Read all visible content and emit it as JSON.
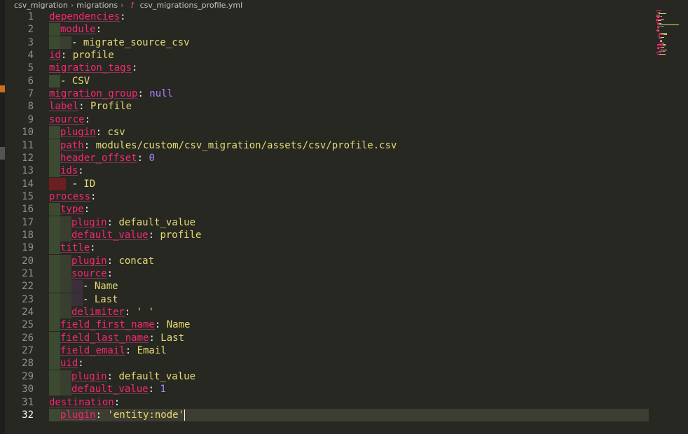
{
  "breadcrumb": {
    "items": [
      "csv_migration",
      "migrations"
    ],
    "icon": "!",
    "file": "csv_migrations_profile.yml"
  },
  "editor": {
    "current_line": 32,
    "lines": [
      {
        "n": "1",
        "indent": 0,
        "tokens": [
          {
            "t": "dependencies",
            "c": "k"
          },
          {
            "t": ":",
            "c": "p"
          }
        ]
      },
      {
        "n": "2",
        "indent": 1,
        "tokens": [
          {
            "t": "module",
            "c": "k"
          },
          {
            "t": ":",
            "c": "p"
          }
        ]
      },
      {
        "n": "3",
        "indent": 2,
        "tokens": [
          {
            "t": "- ",
            "c": "p"
          },
          {
            "t": "migrate_source_csv",
            "c": "s"
          }
        ]
      },
      {
        "n": "4",
        "indent": 0,
        "tokens": [
          {
            "t": "id",
            "c": "k"
          },
          {
            "t": ": ",
            "c": "p"
          },
          {
            "t": "profile",
            "c": "s"
          }
        ]
      },
      {
        "n": "5",
        "indent": 0,
        "tokens": [
          {
            "t": "migration_tags",
            "c": "k"
          },
          {
            "t": ":",
            "c": "p"
          }
        ]
      },
      {
        "n": "6",
        "indent": 1,
        "tokens": [
          {
            "t": "- ",
            "c": "p"
          },
          {
            "t": "CSV",
            "c": "s"
          }
        ]
      },
      {
        "n": "7",
        "indent": 0,
        "tokens": [
          {
            "t": "migration_group",
            "c": "k"
          },
          {
            "t": ": ",
            "c": "p"
          },
          {
            "t": "null",
            "c": "n"
          }
        ]
      },
      {
        "n": "8",
        "indent": 0,
        "tokens": [
          {
            "t": "label",
            "c": "k"
          },
          {
            "t": ": ",
            "c": "p"
          },
          {
            "t": "Profile",
            "c": "s"
          }
        ]
      },
      {
        "n": "9",
        "indent": 0,
        "tokens": [
          {
            "t": "source",
            "c": "k"
          },
          {
            "t": ":",
            "c": "p"
          }
        ]
      },
      {
        "n": "10",
        "indent": 1,
        "tokens": [
          {
            "t": "plugin",
            "c": "k"
          },
          {
            "t": ": ",
            "c": "p"
          },
          {
            "t": "csv",
            "c": "s"
          }
        ]
      },
      {
        "n": "11",
        "indent": 1,
        "tokens": [
          {
            "t": "path",
            "c": "k"
          },
          {
            "t": ": ",
            "c": "p"
          },
          {
            "t": "modules/custom/csv_migration/assets/csv/profile.csv",
            "c": "s"
          }
        ]
      },
      {
        "n": "12",
        "indent": 1,
        "tokens": [
          {
            "t": "header_offset",
            "c": "k"
          },
          {
            "t": ": ",
            "c": "p"
          },
          {
            "t": "0",
            "c": "n"
          }
        ]
      },
      {
        "n": "13",
        "indent": 1,
        "tokens": [
          {
            "t": "ids",
            "c": "k"
          },
          {
            "t": ":",
            "c": "p"
          }
        ]
      },
      {
        "n": "14",
        "indent": -1,
        "tokens": [
          {
            "t": "- ",
            "c": "p"
          },
          {
            "t": "ID",
            "c": "s"
          }
        ]
      },
      {
        "n": "15",
        "indent": 0,
        "tokens": [
          {
            "t": "process",
            "c": "k"
          },
          {
            "t": ":",
            "c": "p"
          }
        ]
      },
      {
        "n": "16",
        "indent": 1,
        "tokens": [
          {
            "t": "type",
            "c": "k"
          },
          {
            "t": ":",
            "c": "p"
          }
        ]
      },
      {
        "n": "17",
        "indent": 2,
        "tokens": [
          {
            "t": "plugin",
            "c": "k"
          },
          {
            "t": ": ",
            "c": "p"
          },
          {
            "t": "default_value",
            "c": "s"
          }
        ]
      },
      {
        "n": "18",
        "indent": 2,
        "tokens": [
          {
            "t": "default_value",
            "c": "k"
          },
          {
            "t": ": ",
            "c": "p"
          },
          {
            "t": "profile",
            "c": "s"
          }
        ]
      },
      {
        "n": "19",
        "indent": 1,
        "tokens": [
          {
            "t": "title",
            "c": "k"
          },
          {
            "t": ":",
            "c": "p"
          }
        ]
      },
      {
        "n": "20",
        "indent": 2,
        "tokens": [
          {
            "t": "plugin",
            "c": "k"
          },
          {
            "t": ": ",
            "c": "p"
          },
          {
            "t": "concat",
            "c": "s"
          }
        ]
      },
      {
        "n": "21",
        "indent": 2,
        "tokens": [
          {
            "t": "source",
            "c": "k"
          },
          {
            "t": ":",
            "c": "p"
          }
        ]
      },
      {
        "n": "22",
        "indent": 3,
        "tokens": [
          {
            "t": "- ",
            "c": "p"
          },
          {
            "t": "Name",
            "c": "s"
          }
        ]
      },
      {
        "n": "23",
        "indent": 3,
        "tokens": [
          {
            "t": "- ",
            "c": "p"
          },
          {
            "t": "Last",
            "c": "s"
          }
        ]
      },
      {
        "n": "24",
        "indent": 2,
        "tokens": [
          {
            "t": "delimiter",
            "c": "k"
          },
          {
            "t": ": ",
            "c": "p"
          },
          {
            "t": "' '",
            "c": "s"
          }
        ]
      },
      {
        "n": "25",
        "indent": 1,
        "tokens": [
          {
            "t": "field_first_name",
            "c": "k"
          },
          {
            "t": ": ",
            "c": "p"
          },
          {
            "t": "Name",
            "c": "s"
          }
        ]
      },
      {
        "n": "26",
        "indent": 1,
        "tokens": [
          {
            "t": "field_last_name",
            "c": "k"
          },
          {
            "t": ": ",
            "c": "p"
          },
          {
            "t": "Last",
            "c": "s"
          }
        ]
      },
      {
        "n": "27",
        "indent": 1,
        "tokens": [
          {
            "t": "field_email",
            "c": "k"
          },
          {
            "t": ": ",
            "c": "p"
          },
          {
            "t": "Email",
            "c": "s"
          }
        ]
      },
      {
        "n": "28",
        "indent": 1,
        "tokens": [
          {
            "t": "uid",
            "c": "k"
          },
          {
            "t": ":",
            "c": "p"
          }
        ]
      },
      {
        "n": "29",
        "indent": 2,
        "tokens": [
          {
            "t": "plugin",
            "c": "k"
          },
          {
            "t": ": ",
            "c": "p"
          },
          {
            "t": "default_value",
            "c": "s"
          }
        ]
      },
      {
        "n": "30",
        "indent": 2,
        "tokens": [
          {
            "t": "default_value",
            "c": "k"
          },
          {
            "t": ": ",
            "c": "p"
          },
          {
            "t": "1",
            "c": "n"
          }
        ]
      },
      {
        "n": "31",
        "indent": 0,
        "tokens": [
          {
            "t": "destination",
            "c": "k"
          },
          {
            "t": ":",
            "c": "p"
          }
        ]
      },
      {
        "n": "32",
        "indent": 1,
        "tokens": [
          {
            "t": "plugin",
            "c": "k"
          },
          {
            "t": ": ",
            "c": "p"
          },
          {
            "t": "'entity:node'",
            "c": "s"
          }
        ]
      }
    ]
  },
  "colors": {
    "background": "#272822",
    "key": "#f92672",
    "string": "#e6db74",
    "number": "#ae81ff",
    "punctuation": "#f8f8f2",
    "line_number": "#90908a"
  }
}
